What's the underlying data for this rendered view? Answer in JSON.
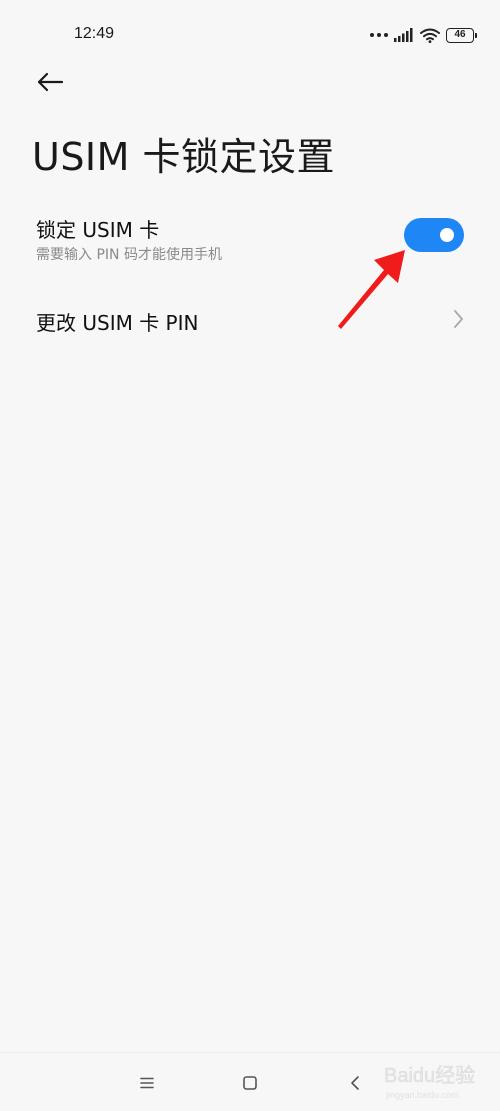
{
  "status_bar": {
    "time": "12:49",
    "battery_level": "46",
    "icons": [
      "signal-dots-icon",
      "cellular-signal-icon",
      "wifi-icon",
      "battery-icon"
    ]
  },
  "header": {
    "back_icon": "arrow-left-icon",
    "title": "USIM 卡锁定设置"
  },
  "settings": {
    "lock_sim": {
      "title": "锁定 USIM 卡",
      "subtitle": "需要输入 PIN 码才能使用手机",
      "enabled": true
    },
    "change_pin": {
      "title": "更改 USIM 卡 PIN",
      "icon": "chevron-right-icon"
    }
  },
  "annotation": {
    "icon": "red-arrow-annotation",
    "color": "#f01c1c"
  },
  "nav_bar": {
    "icons": [
      "menu-icon",
      "home-icon",
      "back-icon"
    ]
  },
  "watermark": {
    "text": "Baidu经验",
    "url": "jingyan.baidu.com"
  },
  "colors": {
    "accent": "#1f86f5",
    "background": "#f7f7f7"
  }
}
